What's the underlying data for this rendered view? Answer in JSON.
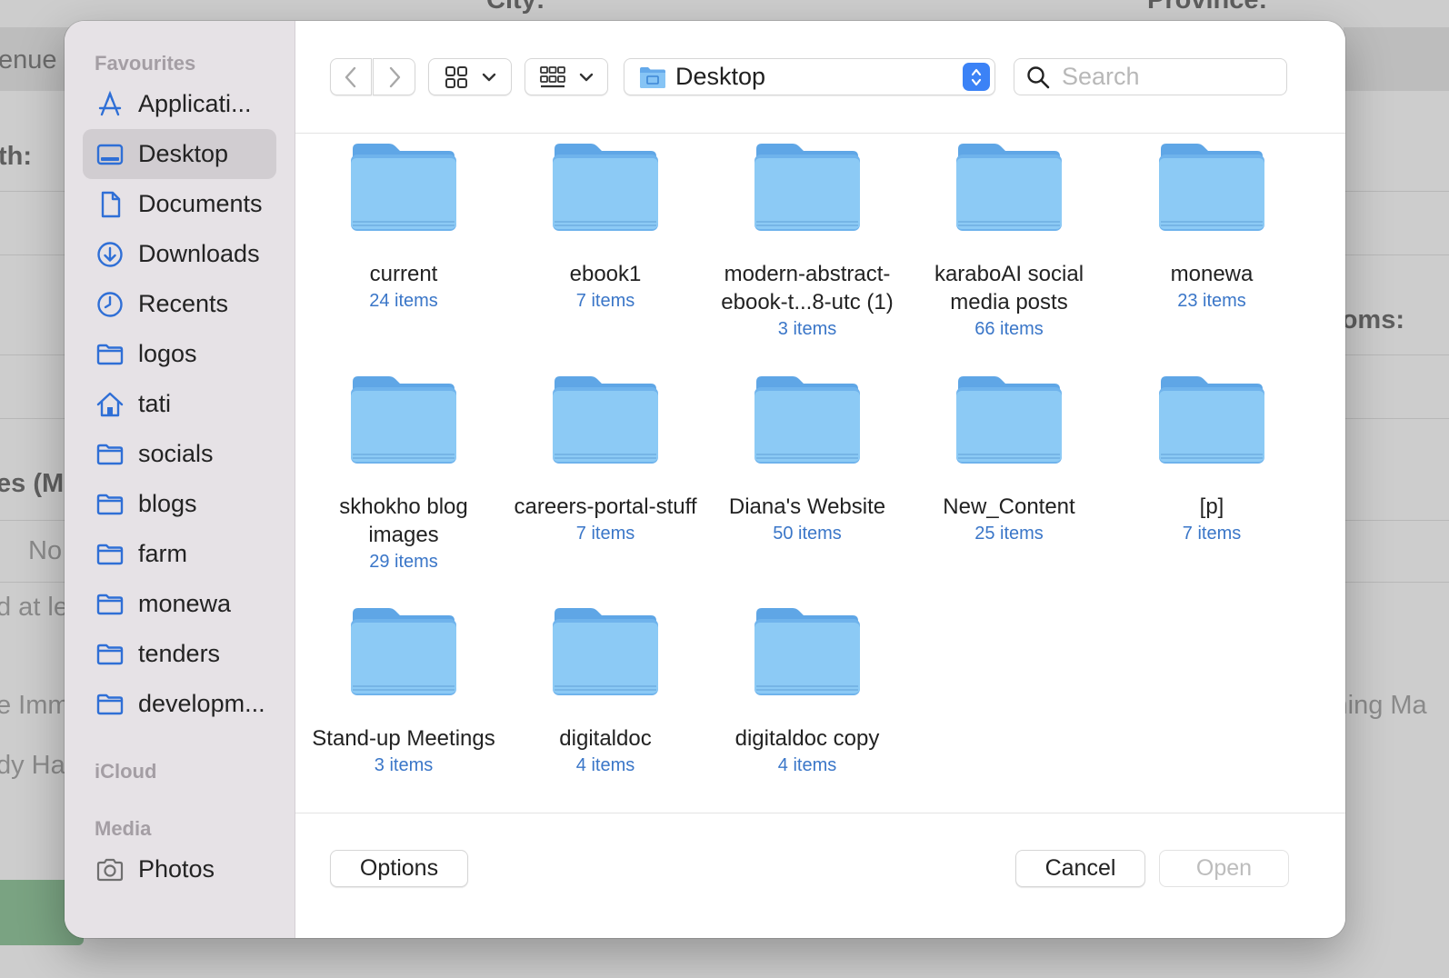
{
  "background_page": {
    "texts": [
      "City:",
      "Province:",
      "enue",
      "th:",
      "ooms:",
      "es (M",
      "No",
      "d at lea",
      "e Imm",
      "shing Ma",
      "dy Ha"
    ]
  },
  "dialog": {
    "sidebar": {
      "sections": [
        {
          "heading": "Favourites",
          "items": [
            {
              "label": "Applicati...",
              "icon": "applications-icon",
              "selected": false
            },
            {
              "label": "Desktop",
              "icon": "desktop-icon",
              "selected": true
            },
            {
              "label": "Documents",
              "icon": "document-icon",
              "selected": false
            },
            {
              "label": "Downloads",
              "icon": "download-icon",
              "selected": false
            },
            {
              "label": "Recents",
              "icon": "clock-icon",
              "selected": false
            },
            {
              "label": "logos",
              "icon": "folder-icon",
              "selected": false
            },
            {
              "label": "tati",
              "icon": "home-icon",
              "selected": false
            },
            {
              "label": "socials",
              "icon": "folder-icon",
              "selected": false
            },
            {
              "label": "blogs",
              "icon": "folder-icon",
              "selected": false
            },
            {
              "label": "farm",
              "icon": "folder-icon",
              "selected": false
            },
            {
              "label": "monewa",
              "icon": "folder-icon",
              "selected": false
            },
            {
              "label": "tenders",
              "icon": "folder-icon",
              "selected": false
            },
            {
              "label": "developm...",
              "icon": "folder-icon",
              "selected": false
            }
          ]
        },
        {
          "heading": "iCloud",
          "items": []
        },
        {
          "heading": "Media",
          "items": [
            {
              "label": "Photos",
              "icon": "camera-icon",
              "selected": false
            }
          ]
        }
      ]
    },
    "toolbar": {
      "location": "Desktop",
      "search_placeholder": "Search",
      "search_value": ""
    },
    "items": [
      {
        "name": "current",
        "count": "24 items"
      },
      {
        "name": "ebook1",
        "count": "7 items"
      },
      {
        "name": "modern-abstract-ebook-t...8-utc (1)",
        "count": "3 items"
      },
      {
        "name": "karaboAI social media posts",
        "count": "66 items"
      },
      {
        "name": "monewa",
        "count": "23 items"
      },
      {
        "name": "skhokho blog images",
        "count": "29 items"
      },
      {
        "name": "careers-portal-stuff",
        "count": "7 items"
      },
      {
        "name": "Diana's Website",
        "count": "50 items"
      },
      {
        "name": "New_Content",
        "count": "25 items"
      },
      {
        "name": "[p]",
        "count": "7 items"
      },
      {
        "name": "Stand-up Meetings",
        "count": "3 items"
      },
      {
        "name": "digitaldoc",
        "count": "4 items"
      },
      {
        "name": "digitaldoc copy",
        "count": "4 items"
      }
    ],
    "footer": {
      "options_label": "Options",
      "cancel_label": "Cancel",
      "open_label": "Open"
    },
    "colors": {
      "accent": "#3b82f6",
      "folder": "#8ccaf5",
      "count_text": "#3a76c8",
      "sidebar_bg": "#e6e2e6"
    }
  }
}
